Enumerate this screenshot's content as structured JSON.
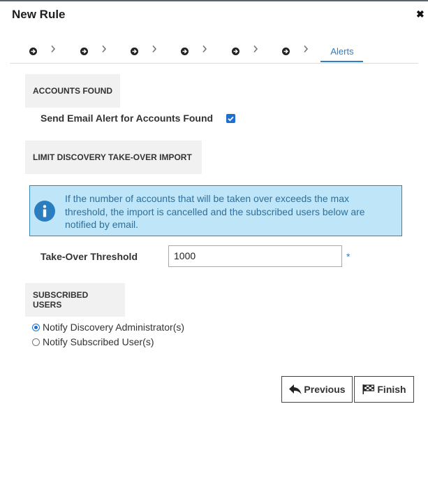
{
  "dialog": {
    "title": "New Rule",
    "close_glyph": "✖"
  },
  "wizard": {
    "completed_steps": 6,
    "active_step_label": "Alerts"
  },
  "accounts_found": {
    "heading": "ACCOUNTS FOUND",
    "send_email_label": "Send Email Alert for Accounts Found",
    "send_email_checked": true
  },
  "limit": {
    "heading": "LIMIT DISCOVERY TAKE-OVER IMPORT",
    "info_text": "If the number of accounts that will be taken over exceeds the max threshold, the import is cancelled and the subscribed users below are notified by email.",
    "threshold_label": "Take-Over Threshold",
    "threshold_value": "1000",
    "required_mark": "*"
  },
  "subscribed": {
    "heading": "SUBSCRIBED USERS",
    "options": [
      {
        "label": "Notify Discovery Administrator(s)",
        "selected": true
      },
      {
        "label": "Notify Subscribed User(s)",
        "selected": false
      }
    ]
  },
  "buttons": {
    "previous": "Previous",
    "finish": "Finish"
  },
  "colors": {
    "accent": "#2e7ec2",
    "info_bg": "#bfe6f8",
    "checkbox": "#1f6fd0"
  }
}
